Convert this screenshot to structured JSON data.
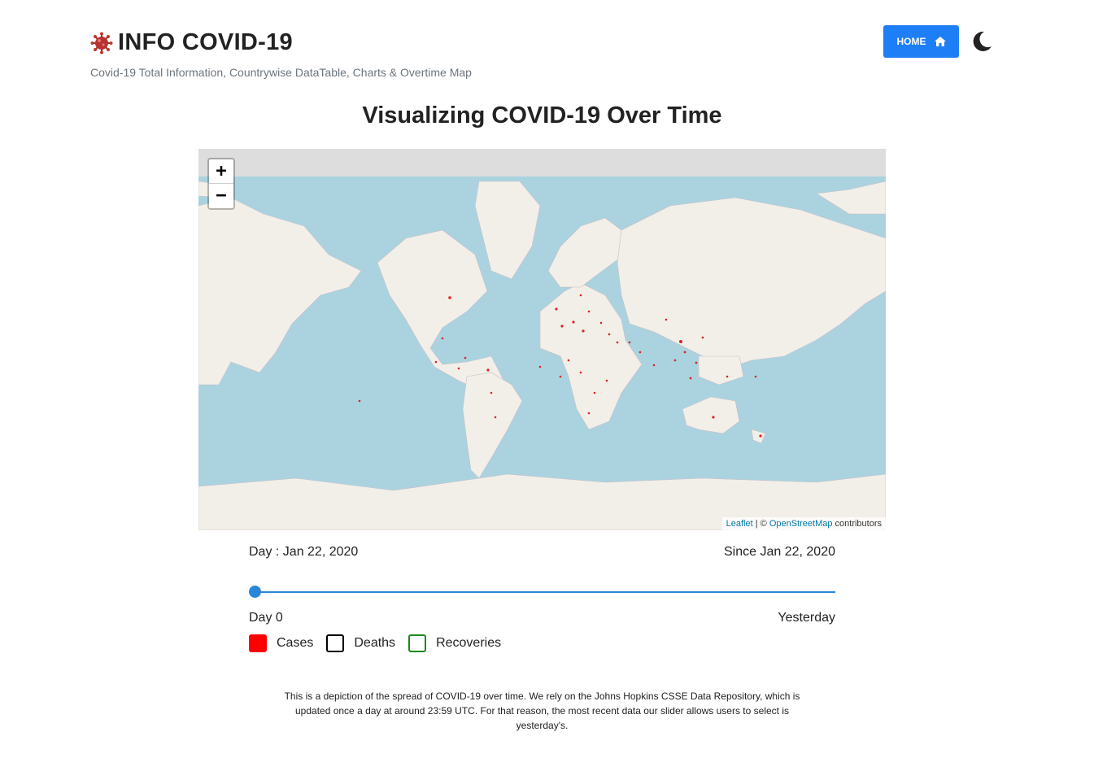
{
  "header": {
    "brand_icon": "virus-icon",
    "title": "INFO COVID-19",
    "subtitle": "Covid-19 Total Information, Countrywise DataTable, Charts & Overtime Map",
    "home_label": "HOME",
    "home_icon": "home-icon",
    "theme_icon": "moon-icon"
  },
  "main": {
    "title": "Visualizing COVID-19 Over Time"
  },
  "map": {
    "zoom_in": "+",
    "zoom_out": "−",
    "attribution_link_1": "Leaflet",
    "attribution_sep": " | © ",
    "attribution_link_2": "OpenStreetMap",
    "attribution_suffix": " contributors"
  },
  "slider": {
    "day_label": "Day : Jan 22, 2020",
    "since_label": "Since Jan 22, 2020",
    "min_label": "Day 0",
    "max_label": "Yesterday",
    "position_fraction": 0
  },
  "legend": {
    "cases": "Cases",
    "deaths": "Deaths",
    "recoveries": "Recoveries"
  },
  "colors": {
    "cases": "#ff0000",
    "deaths": "#000000",
    "recoveries": "#1b8a1b",
    "accent": "#1e7ef5"
  },
  "footnote": "This is a depiction of the spread of COVID-19 over time. We rely on the Johns Hopkins CSSE Data Repository, which is updated once a day at around 23:59 UTC. For that reason, the most recent data our slider allows users to select is yesterday's."
}
